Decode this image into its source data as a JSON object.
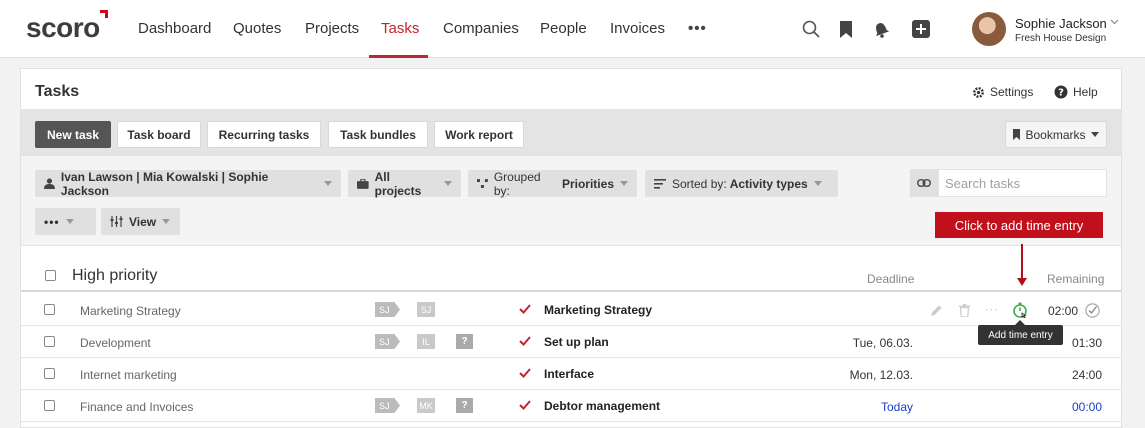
{
  "nav": {
    "logo": "scoro",
    "items": [
      "Dashboard",
      "Quotes",
      "Projects",
      "Tasks",
      "Companies",
      "People",
      "Invoices"
    ],
    "active": "Tasks",
    "more": "•••"
  },
  "user": {
    "name": "Sophie Jackson",
    "company": "Fresh House Design"
  },
  "page": {
    "title": "Tasks",
    "settings": "Settings",
    "help": "Help"
  },
  "toolbar": {
    "buttons": [
      "New task",
      "Task board",
      "Recurring tasks",
      "Task bundles",
      "Work report"
    ],
    "bookmarks": "Bookmarks"
  },
  "filters": {
    "people": "Ivan Lawson | Mia Kowalski | Sophie Jackson",
    "projects": "All projects",
    "grouped_prefix": "Grouped by:",
    "grouped_value": "Priorities",
    "sorted_prefix": "Sorted by:",
    "sorted_value": "Activity types",
    "more": "•••",
    "view": "View",
    "search_placeholder": "Search tasks"
  },
  "callout": "Click to add time entry",
  "tooltip": "Add time entry",
  "group": {
    "title": "High priority",
    "col_deadline": "Deadline",
    "col_remaining": "Remaining"
  },
  "rows": [
    {
      "project": "Marketing Strategy",
      "tags": [
        "SJ",
        "SJ"
      ],
      "task": "Marketing Strategy",
      "deadline": "",
      "remaining": "02:00"
    },
    {
      "project": "Development",
      "tags": [
        "SJ",
        "IL",
        "?"
      ],
      "task": "Set up plan",
      "deadline": "Tue, 06.03.",
      "remaining": "01:30"
    },
    {
      "project": "Internet marketing",
      "tags": [],
      "task": "Interface",
      "deadline": "Mon, 12.03.",
      "remaining": "24:00"
    },
    {
      "project": "Finance and Invoices",
      "tags": [
        "SJ",
        "MK",
        "?"
      ],
      "task": "Debtor management",
      "deadline": "Today",
      "remaining": "00:00"
    }
  ],
  "colors": {
    "accent": "#c0262d",
    "callout": "#c0101c",
    "link_blue": "#1a3fc4"
  }
}
